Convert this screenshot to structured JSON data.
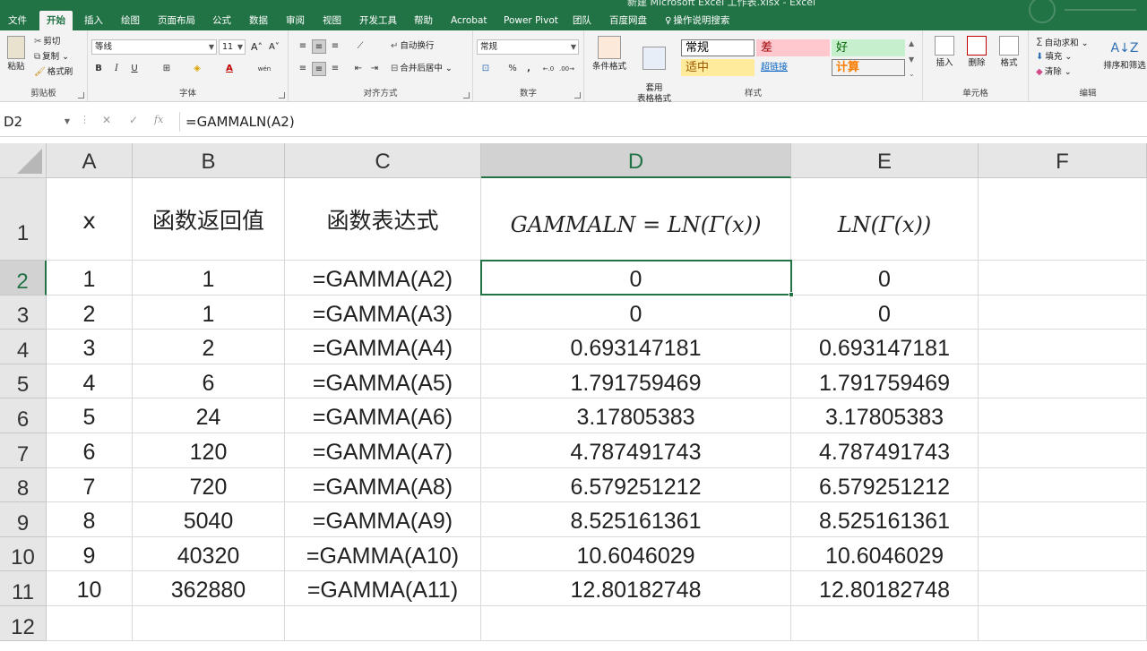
{
  "window": {
    "title": "新建 Microsoft Excel 工作表.xlsx - Excel"
  },
  "ribbon_tabs": [
    "文件",
    "开始",
    "插入",
    "绘图",
    "页面布局",
    "公式",
    "数据",
    "审阅",
    "视图",
    "开发工具",
    "帮助",
    "Acrobat",
    "Power Pivot",
    "团队",
    "百度网盘",
    "操作说明搜索"
  ],
  "ribbon_active_tab": "开始",
  "clipboard": {
    "paste_label": "粘贴",
    "cut_label": "剪切",
    "copy_label": "复制",
    "format_painter_label": "格式刷",
    "group_label": "剪贴板"
  },
  "font": {
    "font_name": "等线",
    "font_size": "11",
    "grow": "A",
    "shrink": "A",
    "bold": "B",
    "italic": "I",
    "underline": "U",
    "font_color_letter": "A",
    "phonetic": "wén",
    "group_label": "字体"
  },
  "alignment": {
    "wrap_text_label": "自动换行",
    "merge_center_label": "合并后居中",
    "group_label": "对齐方式"
  },
  "number": {
    "format": "常规",
    "percent": "%",
    "comma": ",",
    "group_label": "数字"
  },
  "styles": {
    "conditional_label": "条件格式",
    "table_label": "套用\n表格格式",
    "cells": [
      "常规",
      "差",
      "好",
      "适中",
      "超链接",
      "计算"
    ],
    "group_label": "样式"
  },
  "cells_group": {
    "insert_label": "插入",
    "delete_label": "删除",
    "format_label": "格式",
    "group_label": "单元格"
  },
  "editing": {
    "autosum_label": "自动求和",
    "fill_label": "填充",
    "clear_label": "清除",
    "sort_label": "排序和筛选",
    "group_label": "编辑"
  },
  "formula_bar": {
    "name_box": "D2",
    "fx": "fx",
    "formula": "=GAMMALN(A2)"
  },
  "columns": [
    "A",
    "B",
    "C",
    "D",
    "E",
    "F"
  ],
  "active_column": "D",
  "active_row": "2",
  "header_row": {
    "row": "1",
    "A": "x",
    "B": "函数返回值",
    "C": "函数表达式",
    "D": "GAMMALN = LN(Γ(x))",
    "E": "LN(Γ(x))"
  },
  "rows": [
    {
      "row": "2",
      "A": "1",
      "B": "1",
      "C": "=GAMMA(A2)",
      "D": "0",
      "E": "0"
    },
    {
      "row": "3",
      "A": "2",
      "B": "1",
      "C": "=GAMMA(A3)",
      "D": "0",
      "E": "0"
    },
    {
      "row": "4",
      "A": "3",
      "B": "2",
      "C": "=GAMMA(A4)",
      "D": "0.693147181",
      "E": "0.693147181"
    },
    {
      "row": "5",
      "A": "4",
      "B": "6",
      "C": "=GAMMA(A5)",
      "D": "1.791759469",
      "E": "1.791759469"
    },
    {
      "row": "6",
      "A": "5",
      "B": "24",
      "C": "=GAMMA(A6)",
      "D": "3.17805383",
      "E": "3.17805383"
    },
    {
      "row": "7",
      "A": "6",
      "B": "120",
      "C": "=GAMMA(A7)",
      "D": "4.787491743",
      "E": "4.787491743"
    },
    {
      "row": "8",
      "A": "7",
      "B": "720",
      "C": "=GAMMA(A8)",
      "D": "6.579251212",
      "E": "6.579251212"
    },
    {
      "row": "9",
      "A": "8",
      "B": "5040",
      "C": "=GAMMA(A9)",
      "D": "8.525161361",
      "E": "8.525161361"
    },
    {
      "row": "10",
      "A": "9",
      "B": "40320",
      "C": "=GAMMA(A10)",
      "D": "10.6046029",
      "E": "10.6046029"
    },
    {
      "row": "11",
      "A": "10",
      "B": "362880",
      "C": "=GAMMA(A11)",
      "D": "12.80182748",
      "E": "12.80182748"
    },
    {
      "row": "12",
      "A": "",
      "B": "",
      "C": "",
      "D": "",
      "E": ""
    }
  ],
  "colors": {
    "excel_green": "#217346",
    "style_bad_bg": "#ffc7ce",
    "style_bad_fg": "#9c0006",
    "style_good_bg": "#c6efce",
    "style_good_fg": "#006100",
    "style_neutral_bg": "#ffeb9c",
    "style_neutral_fg": "#9c5700",
    "style_calc_fg": "#fa7d00",
    "hyperlink": "#0563c1"
  }
}
